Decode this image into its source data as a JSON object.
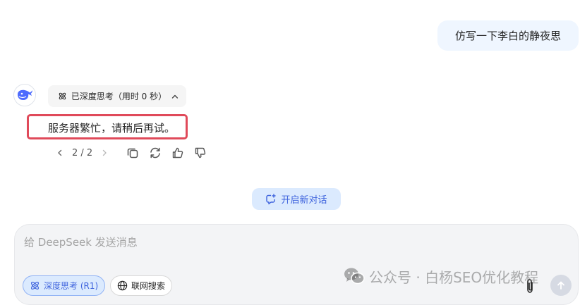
{
  "user_message": "仿写一下李白的静夜思",
  "assistant": {
    "thinking_label": "已深度思考（用时 0 秒）",
    "response_text": "服务器繁忙，请稍后再试。",
    "pager": "2 / 2"
  },
  "new_chat_label": "开启新对话",
  "composer": {
    "placeholder": "给 DeepSeek 发送消息",
    "deep_think_label": "深度思考 (R1)",
    "web_search_label": "联网搜索"
  },
  "watermark": "公众号 · 白杨SEO优化教程",
  "colors": {
    "accent": "#3e63dd",
    "user_bubble": "#eff6ff",
    "highlight_box": "#e04a5a"
  }
}
